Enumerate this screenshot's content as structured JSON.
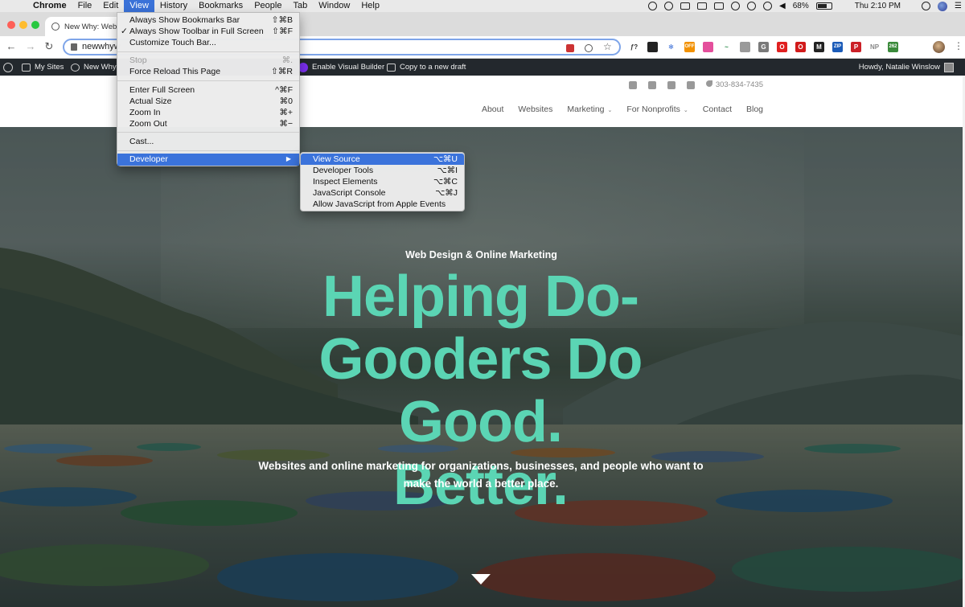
{
  "menubar": {
    "app_name": "Chrome",
    "items": [
      "File",
      "Edit",
      "View",
      "History",
      "Bookmarks",
      "People",
      "Tab",
      "Window",
      "Help"
    ],
    "active_item": "View",
    "battery": "68%",
    "clock": "Thu 2:10 PM"
  },
  "tab": {
    "title": "New Why: Web"
  },
  "toolbar": {
    "url": "newwhyw"
  },
  "wpbar": {
    "my_sites": "My Sites",
    "site_name": "New Why",
    "visual_builder": "Enable Visual Builder",
    "copy_draft": "Copy to a new draft",
    "howdy": "Howdy, Natalie Winslow"
  },
  "site": {
    "phone": "303-834-7435",
    "nav": [
      "About",
      "Websites",
      "Marketing",
      "For Nonprofits",
      "Contact",
      "Blog"
    ]
  },
  "hero": {
    "subtitle": "Web Design & Online Marketing",
    "title_line1": "Helping Do-",
    "title_line2": "Gooders Do Good.",
    "title_line3": "Better.",
    "desc_line1": "Websites and online marketing for organizations, businesses, and people who want to",
    "desc_line2": "make the world a better place."
  },
  "view_menu": {
    "items": [
      {
        "label": "Always Show Bookmarks Bar",
        "shortcut": "⇧⌘B"
      },
      {
        "label": "Always Show Toolbar in Full Screen",
        "shortcut": "⇧⌘F",
        "checked": "✓"
      },
      {
        "label": "Customize Touch Bar...",
        "shortcut": ""
      },
      {
        "label": "Stop",
        "shortcut": "⌘."
      },
      {
        "label": "Force Reload This Page",
        "shortcut": "⇧⌘R"
      },
      {
        "label": "Enter Full Screen",
        "shortcut": "^⌘F"
      },
      {
        "label": "Actual Size",
        "shortcut": "⌘0"
      },
      {
        "label": "Zoom In",
        "shortcut": "⌘+"
      },
      {
        "label": "Zoom Out",
        "shortcut": "⌘−"
      },
      {
        "label": "Cast...",
        "shortcut": ""
      },
      {
        "label": "Developer",
        "shortcut": "▶"
      }
    ]
  },
  "developer_menu": {
    "items": [
      {
        "label": "View Source",
        "shortcut": "⌥⌘U"
      },
      {
        "label": "Developer Tools",
        "shortcut": "⌥⌘I"
      },
      {
        "label": "Inspect Elements",
        "shortcut": "⌥⌘C"
      },
      {
        "label": "JavaScript Console",
        "shortcut": "⌥⌘J"
      },
      {
        "label": "Allow JavaScript from Apple Events",
        "shortcut": ""
      }
    ]
  },
  "extensions": [
    {
      "name": "function-extension",
      "text": "ƒ?",
      "color": "#ffffff",
      "fg": "#333333"
    },
    {
      "name": "shield-extension",
      "text": "",
      "color": "#222222",
      "fg": "#ffffff"
    },
    {
      "name": "snowflake-extension",
      "text": "✻",
      "color": "#ffffff",
      "fg": "#3a6ed6"
    },
    {
      "name": "off-coupon-extension",
      "text": "OFF",
      "color": "#f29100",
      "fg": "#ffffff"
    },
    {
      "name": "color-wheel-extension",
      "text": "",
      "color": "#e44f9c",
      "fg": "#ffffff"
    },
    {
      "name": "wave-extension",
      "text": "~",
      "color": "#ffffff",
      "fg": "#2a8c4a"
    },
    {
      "name": "circle-extension",
      "text": "",
      "color": "#9a9a9a",
      "fg": "#ffffff"
    },
    {
      "name": "g-extension",
      "text": "G",
      "color": "#7a7a7a",
      "fg": "#ffffff"
    },
    {
      "name": "opera-extension",
      "text": "O",
      "color": "#e02020",
      "fg": "#ffffff"
    },
    {
      "name": "red-o-extension",
      "text": "O",
      "color": "#d11a1a",
      "fg": "#ffffff"
    },
    {
      "name": "m-extension",
      "text": "M",
      "color": "#222222",
      "fg": "#ffffff"
    },
    {
      "name": "blue-extension",
      "text": "ZIP",
      "color": "#1b5bb8",
      "fg": "#ffffff"
    },
    {
      "name": "pinterest-extension",
      "text": "P",
      "color": "#cb2027",
      "fg": "#ffffff"
    },
    {
      "name": "np-extension",
      "text": "NP",
      "color": "#ffffff",
      "fg": "#888888"
    },
    {
      "name": "counter-extension",
      "text": "262",
      "color": "#3b8a3b",
      "fg": "#ffffff"
    }
  ]
}
